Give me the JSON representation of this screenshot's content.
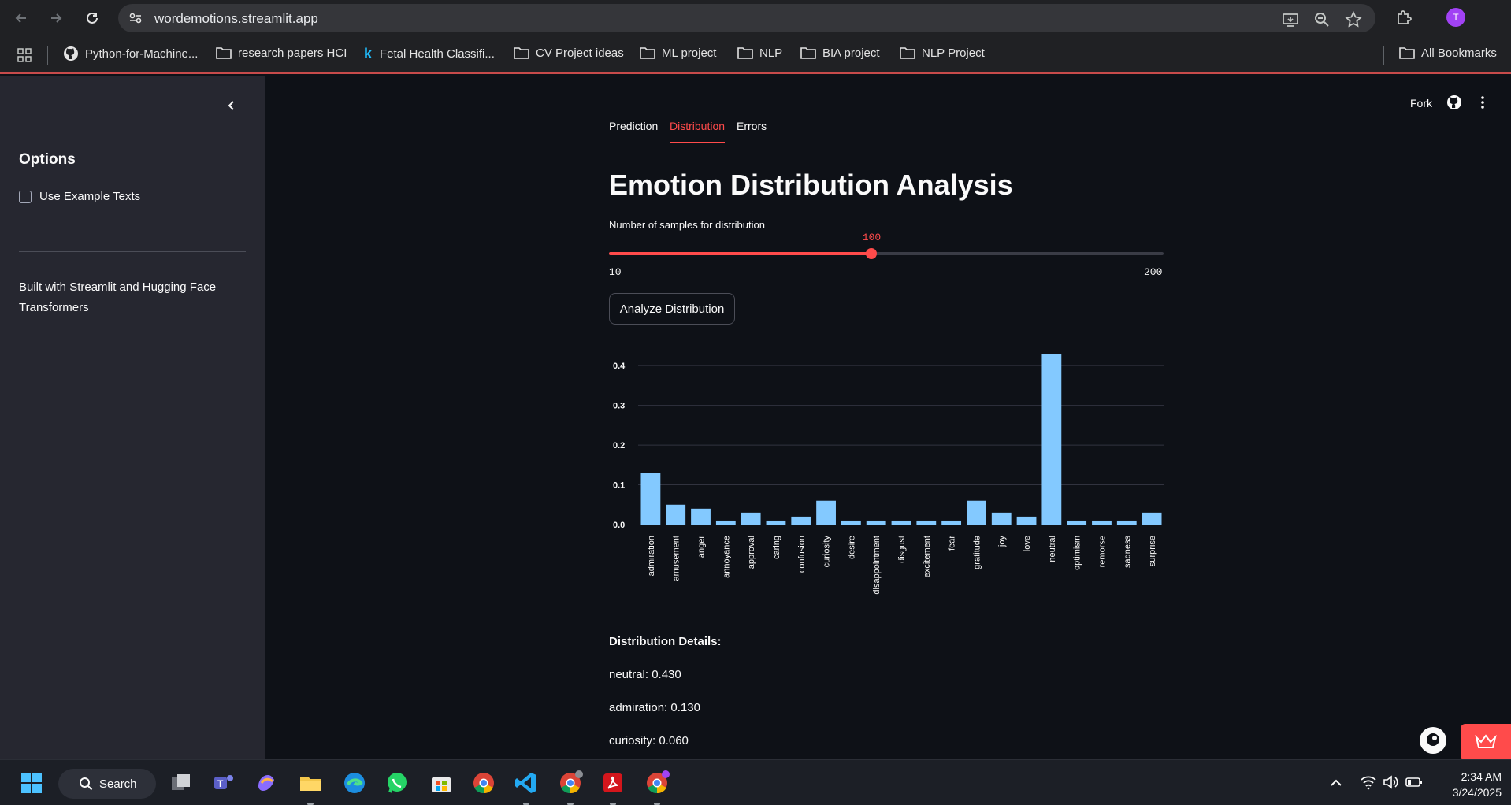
{
  "browser": {
    "url": "wordemotions.streamlit.app",
    "profile_initial": "T",
    "bookmarks": [
      {
        "label": "Python-for-Machine...",
        "icon": "github-icon"
      },
      {
        "label": "research papers HCI",
        "icon": "folder-icon"
      },
      {
        "label": "Fetal Health Classifi...",
        "icon": "kaggle-icon"
      },
      {
        "label": "CV Project ideas",
        "icon": "folder-icon"
      },
      {
        "label": "ML project",
        "icon": "folder-icon"
      },
      {
        "label": "NLP",
        "icon": "folder-icon"
      },
      {
        "label": "BIA project",
        "icon": "folder-icon"
      },
      {
        "label": "NLP Project",
        "icon": "folder-icon"
      }
    ],
    "all_bookmarks": "All Bookmarks"
  },
  "sidebar": {
    "title": "Options",
    "checkbox_label": "Use Example Texts",
    "footer": "Built with Streamlit and Hugging Face Transformers"
  },
  "header": {
    "fork": "Fork"
  },
  "tabs": [
    {
      "label": "Prediction",
      "active": false
    },
    {
      "label": "Distribution",
      "active": true
    },
    {
      "label": "Errors",
      "active": false
    }
  ],
  "main": {
    "title": "Emotion Distribution Analysis",
    "slider": {
      "label": "Number of samples for distribution",
      "min": 10,
      "max": 200,
      "value": 100,
      "min_label": "10",
      "max_label": "200",
      "value_label": "100"
    },
    "button": "Analyze Distribution",
    "details_title": "Distribution Details:",
    "details": [
      "neutral: 0.430",
      "admiration: 0.130",
      "curiosity: 0.060"
    ]
  },
  "chart_data": {
    "type": "bar",
    "categories": [
      "admiration",
      "amusement",
      "anger",
      "annoyance",
      "approval",
      "caring",
      "confusion",
      "curiosity",
      "desire",
      "disappointment",
      "disgust",
      "excitement",
      "fear",
      "gratitude",
      "joy",
      "love",
      "neutral",
      "optimism",
      "remorse",
      "sadness",
      "surprise"
    ],
    "values": [
      0.13,
      0.05,
      0.04,
      0.01,
      0.03,
      0.01,
      0.02,
      0.06,
      0.01,
      0.01,
      0.01,
      0.01,
      0.01,
      0.06,
      0.03,
      0.02,
      0.43,
      0.01,
      0.01,
      0.01,
      0.03
    ],
    "yticks": [
      "0.0",
      "0.1",
      "0.2",
      "0.3",
      "0.4"
    ],
    "ylim": [
      0,
      0.44
    ],
    "grid": true,
    "bar_color": "#83c9ff"
  },
  "taskbar": {
    "search_label": "Search",
    "time": "2:34 AM",
    "date": "3/24/2025"
  },
  "colors": {
    "accent": "#ff4b4b",
    "background": "#0e1117",
    "sidebar": "#262730"
  }
}
